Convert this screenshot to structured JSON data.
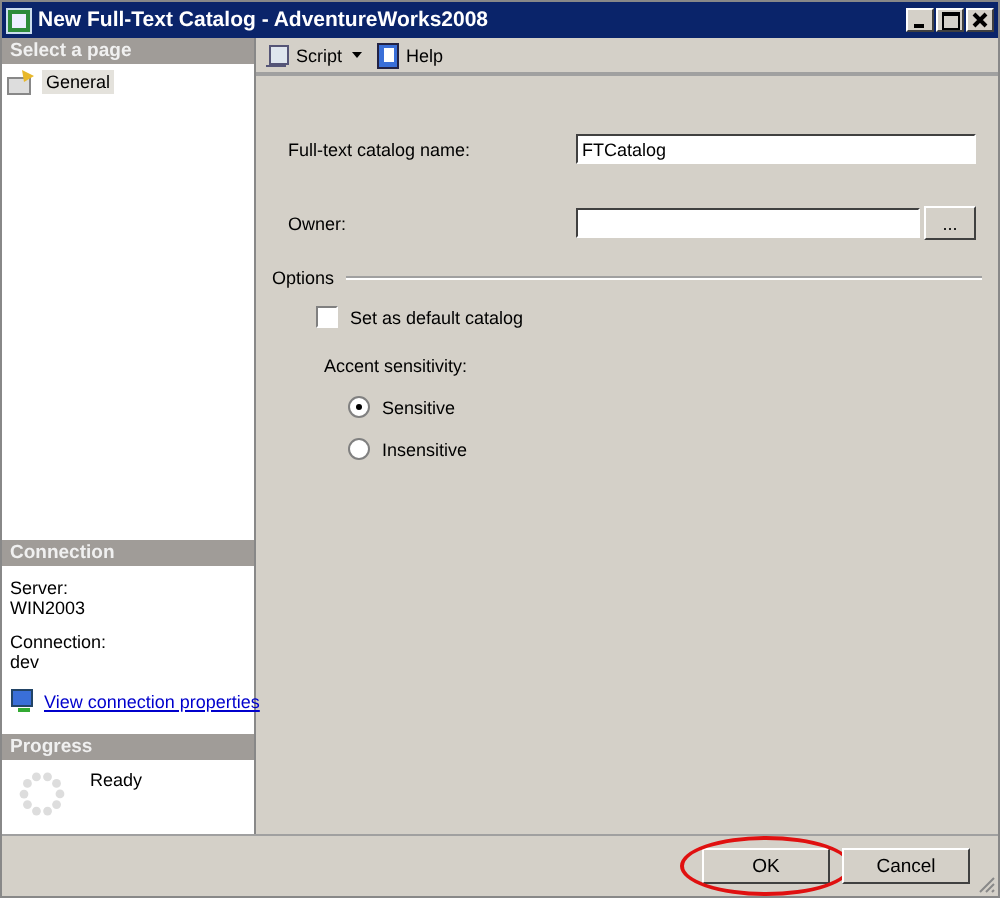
{
  "window": {
    "title": "New Full-Text Catalog - AdventureWorks2008"
  },
  "sidebar": {
    "header": "Select a page",
    "pages": [
      {
        "label": "General",
        "selected": true
      }
    ]
  },
  "connection": {
    "header": "Connection",
    "server_label": "Server:",
    "server": "WIN2003",
    "connection_label": "Connection:",
    "connection": "dev",
    "link": "View connection properties"
  },
  "progress": {
    "header": "Progress",
    "status": "Ready"
  },
  "toolbar": [
    {
      "label": "Script",
      "kind": "script",
      "dropdown": true
    },
    {
      "label": "Help",
      "kind": "help",
      "dropdown": false
    }
  ],
  "form": {
    "name_label": "Full-text catalog name:",
    "name_value": "FTCatalog",
    "owner_label": "Owner:",
    "browse_button": "...",
    "options_header": "Options",
    "default_catalog": {
      "label": "Set as default catalog",
      "checked": false
    },
    "accent_label": "Accent sensitivity:",
    "accent_options": [
      {
        "label": "Sensitive",
        "selected": true
      },
      {
        "label": "Insensitive",
        "selected": false
      }
    ]
  },
  "buttons": [
    {
      "label": "OK",
      "circled": true
    },
    {
      "label": "Cancel",
      "circled": false
    }
  ]
}
